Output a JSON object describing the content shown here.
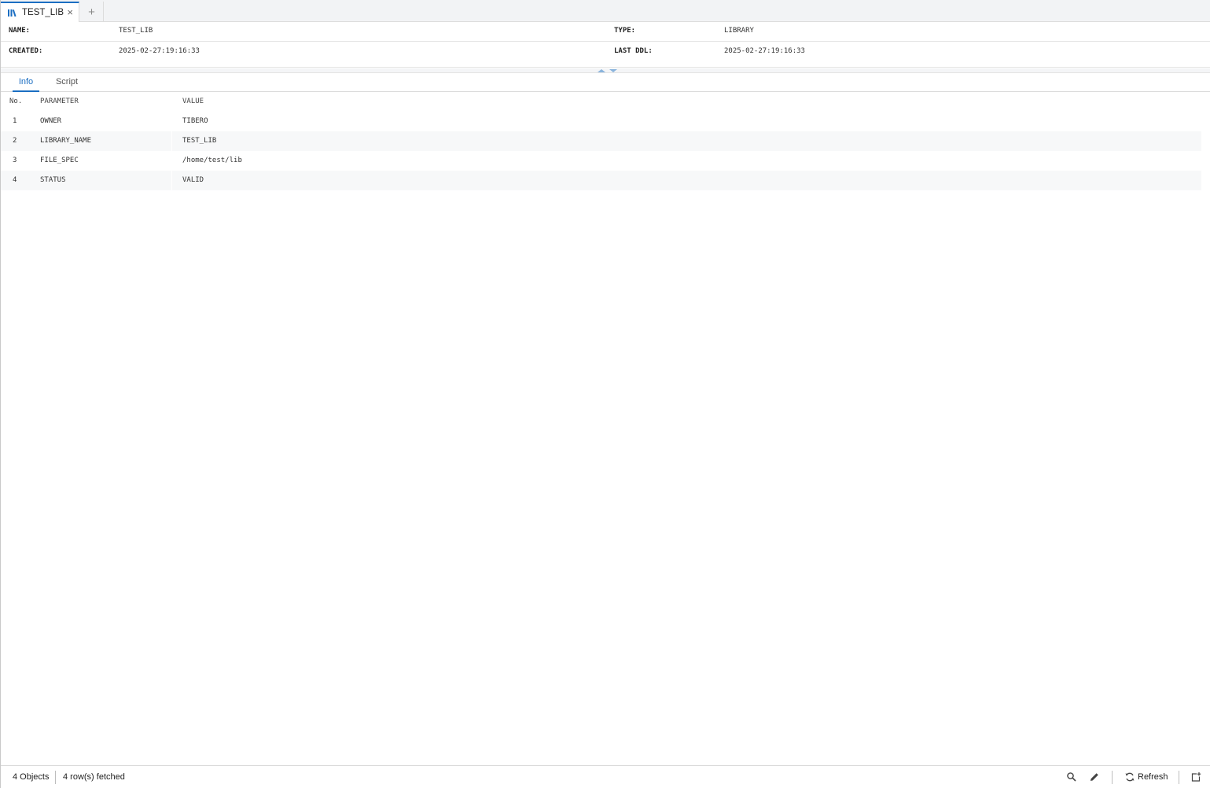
{
  "tab": {
    "label": "TEST_LIB",
    "icon": "library-icon",
    "close": "×",
    "add": "+"
  },
  "header": {
    "name_label": "NAME:",
    "name_value": "TEST_LIB",
    "type_label": "TYPE:",
    "type_value": "LIBRARY",
    "created_label": "CREATED:",
    "created_value": "2025-02-27:19:16:33",
    "ddl_label": "LAST DDL:",
    "ddl_value": "2025-02-27:19:16:33"
  },
  "subtabs": {
    "info": "Info",
    "script": "Script",
    "active": "Info"
  },
  "grid": {
    "columns": [
      "No.",
      "PARAMETER",
      "VALUE"
    ],
    "rows": [
      {
        "no": "1",
        "param": "OWNER",
        "value": "TIBERO"
      },
      {
        "no": "2",
        "param": "LIBRARY_NAME",
        "value": "TEST_LIB"
      },
      {
        "no": "3",
        "param": "FILE_SPEC",
        "value": "/home/test/lib"
      },
      {
        "no": "4",
        "param": "STATUS",
        "value": "VALID"
      }
    ]
  },
  "status": {
    "objects": "4 Objects",
    "fetched": "4 row(s) fetched",
    "refresh_label": "Refresh"
  },
  "colors": {
    "accent": "#1b6ec2",
    "splitter_arrow": "#8ab4dd"
  }
}
